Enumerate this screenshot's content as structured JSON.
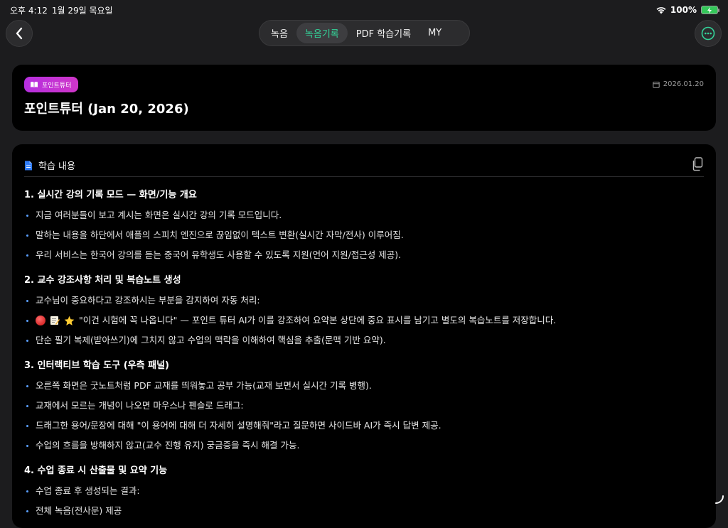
{
  "status_bar": {
    "time": "오후 4:12",
    "date": "1월 29일 목요일",
    "battery": "100%"
  },
  "nav": {
    "tabs": [
      {
        "label": "녹음",
        "active": false
      },
      {
        "label": "녹음기록",
        "active": true
      },
      {
        "label": "PDF 학습기록",
        "active": false
      },
      {
        "label": "MY",
        "active": false
      }
    ]
  },
  "header": {
    "badge": "포인트튜터",
    "date": "2026.01.20",
    "title": "포인트튜터 (Jan 20, 2026)"
  },
  "content": {
    "label": "학습 내용",
    "sections": [
      {
        "title": "1. 실시간 강의 기록 모드 — 화면/기능 개요",
        "bullets": [
          "지금 여러분들이 보고 계시는 화면은 실시간 강의 기록 모드입니다.",
          "말하는 내용을 하단에서 애플의 스피치 엔진으로 끊임없이 텍스트 변환(실시간 자막/전사) 이루어짐.",
          "우리 서비스는 한국어 강의를 듣는 중국어 유학생도 사용할 수 있도록 지원(언어 지원/접근성 제공)."
        ]
      },
      {
        "title": "2. 교수 강조사항 처리 및 복습노트 생성",
        "bullets": [
          "교수님이 중요하다고 강조하시는 부분을 감지하여 자동 처리:",
          "\"이건 시험에 꼭 나옵니다\" — 포인트 튜터 AI가 이를 강조하여 요약본 상단에 중요 표시를 남기고 별도의 복습노트를 저장합니다.",
          "단순 필기 복제(받아쓰기)에 그치지 않고 수업의 맥락을 이해하여 핵심을 추출(문맥 기반 요약)."
        ]
      },
      {
        "title": "3. 인터랙티브 학습 도구 (우측 패널)",
        "bullets": [
          "오른쪽 화면은 굿노트처럼 PDF 교재를 띄워놓고 공부 가능(교재 보면서 실시간 기록 병행).",
          "교재에서 모르는 개념이 나오면 마우스나 펜슬로 드래그:",
          "드래그한 용어/문장에 대해 \"이 용어에 대해 더 자세히 설명해줘\"라고 질문하면 사이드바 AI가 즉시 답변 제공.",
          "수업의 흐름을 방해하지 않고(교수 진행 유지) 궁금증을 즉시 해결 가능."
        ]
      },
      {
        "title": "4. 수업 종료 시 산출물 및 요약 기능",
        "bullets": [
          "수업 종료 후 생성되는 결과:",
          "전체 녹음(전사문) 제공"
        ]
      }
    ]
  },
  "colors": {
    "accent_green": "#34d399",
    "bullet_blue": "#5aa0ff",
    "badge_purple": "#c032d6"
  }
}
